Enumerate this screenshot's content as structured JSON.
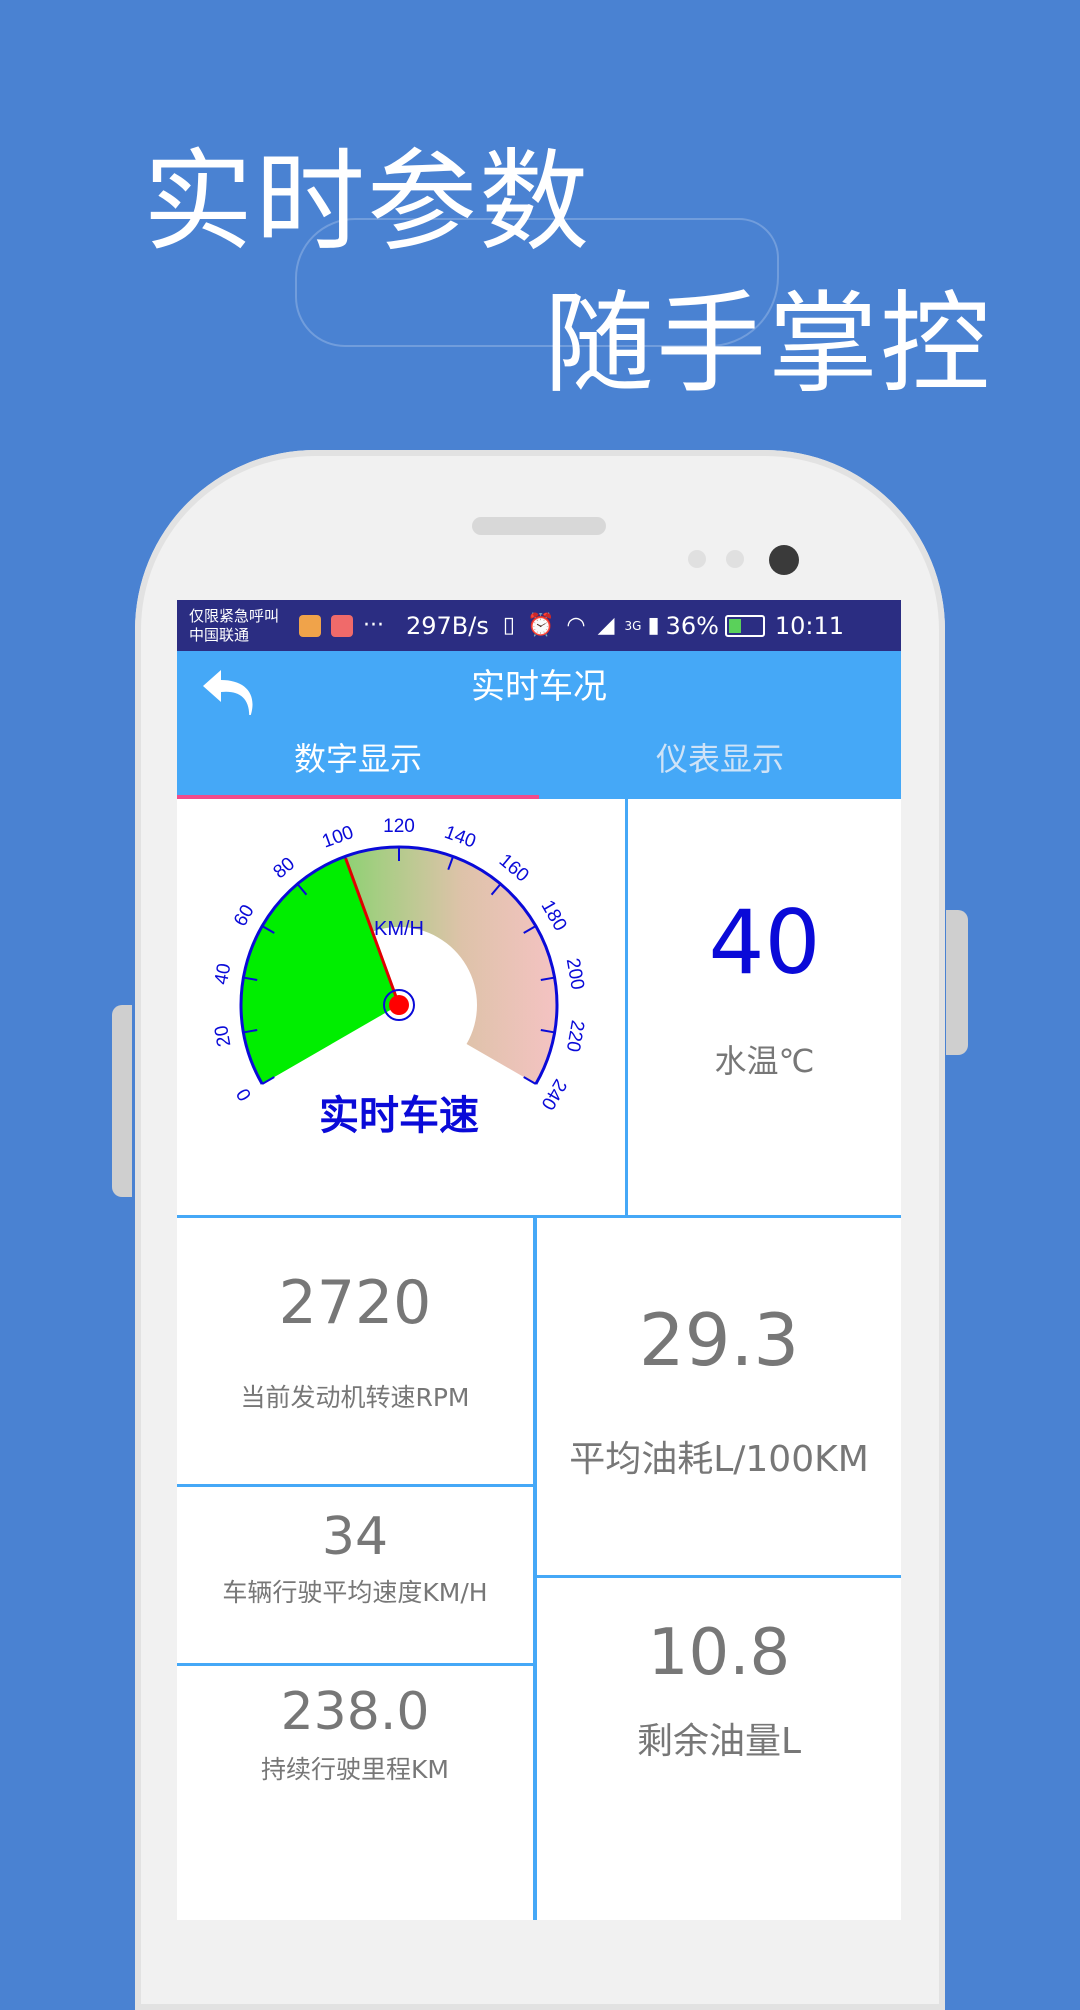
{
  "promo": {
    "line1": "实时参数",
    "line2": "随手掌控"
  },
  "statusbar": {
    "carrier_line1": "仅限紧急呼叫",
    "carrier_line2": "中国联通",
    "more": "···",
    "speed": "297B/s",
    "network": "3G",
    "battery": "36%",
    "time": "10:11"
  },
  "titlebar": {
    "title": "实时车况"
  },
  "tabs": [
    {
      "label": "数字显示",
      "active": true
    },
    {
      "label": "仪表显示",
      "active": false
    }
  ],
  "gauge": {
    "unit": "KM/H",
    "label": "实时车速",
    "ticks": [
      "0",
      "20",
      "40",
      "60",
      "80",
      "100",
      "120",
      "140",
      "160",
      "180",
      "200",
      "220",
      "240"
    ],
    "value": 100
  },
  "water": {
    "value": "40",
    "label": "水温℃"
  },
  "rpm": {
    "value": "2720",
    "label": "当前发动机转速RPM"
  },
  "fuel_avg": {
    "value": "29.3",
    "label": "平均油耗L/100KM"
  },
  "avg_speed": {
    "value": "34",
    "label": "车辆行驶平均速度KM/H"
  },
  "mileage": {
    "value": "238.0",
    "label": "持续行驶里程KM"
  },
  "fuel_left": {
    "value": "10.8",
    "label": "剩余油量L"
  },
  "colors": {
    "background": "#4a82d2",
    "appbar": "#45a8f7",
    "statusbar": "#2b2d82",
    "indicator": "#f24b8b",
    "gauge_blue": "#0a0ad8",
    "water_value": "#0a0ad8"
  }
}
